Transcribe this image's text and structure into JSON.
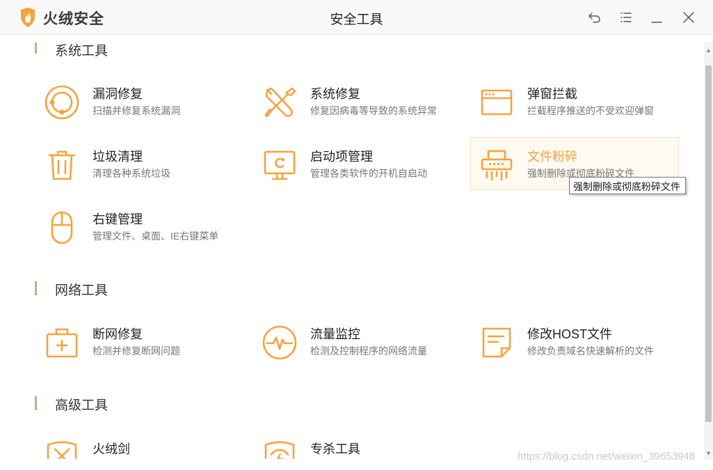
{
  "app": {
    "brand": "火绒安全",
    "window_title": "安全工具",
    "accent_color": "#f7a23a"
  },
  "window_controls": [
    {
      "icon": "back-arrow-icon"
    },
    {
      "icon": "menu-list-icon"
    },
    {
      "icon": "minimize-icon"
    },
    {
      "icon": "close-icon"
    }
  ],
  "sections": {
    "system": {
      "title": "系统工具",
      "tools": [
        {
          "name": "漏洞修复",
          "desc": "扫描并修复系统漏洞",
          "icon": "vulnerability-fix-icon"
        },
        {
          "name": "系统修复",
          "desc": "修复因病毒等导致的系统异常",
          "icon": "wrench-screwdriver-icon"
        },
        {
          "name": "弹窗拦截",
          "desc": "拦截程序推送的不受欢迎弹窗",
          "icon": "popup-window-icon"
        },
        {
          "name": "垃圾清理",
          "desc": "清理各种系统垃圾",
          "icon": "trash-can-icon"
        },
        {
          "name": "启动项管理",
          "desc": "管理各类软件的开机自启动",
          "icon": "monitor-refresh-icon"
        },
        {
          "name": "文件粉碎",
          "desc": "强制删除或彻底粉碎文件",
          "icon": "file-shredder-icon"
        },
        {
          "name": "右键管理",
          "desc": "管理文件、桌面、IE右键菜单",
          "icon": "mouse-icon"
        }
      ]
    },
    "network": {
      "title": "网络工具",
      "tools": [
        {
          "name": "断网修复",
          "desc": "检测并修复断网问题",
          "icon": "first-aid-kit-icon"
        },
        {
          "name": "流量监控",
          "desc": "检测及控制程序的网络流量",
          "icon": "traffic-pulse-icon"
        },
        {
          "name": "修改HOST文件",
          "desc": "修改负责域名快速解析的文件",
          "icon": "note-document-icon"
        }
      ]
    },
    "advanced": {
      "title": "高级工具",
      "tools": [
        {
          "name": "火绒剑",
          "icon": "shield-sword-icon"
        },
        {
          "name": "专杀工具",
          "icon": "shield-bolt-icon"
        }
      ]
    }
  },
  "tooltip": "强制删除或彻底粉碎文件",
  "watermark": "https://blog.csdn.net/weixin_39653948"
}
